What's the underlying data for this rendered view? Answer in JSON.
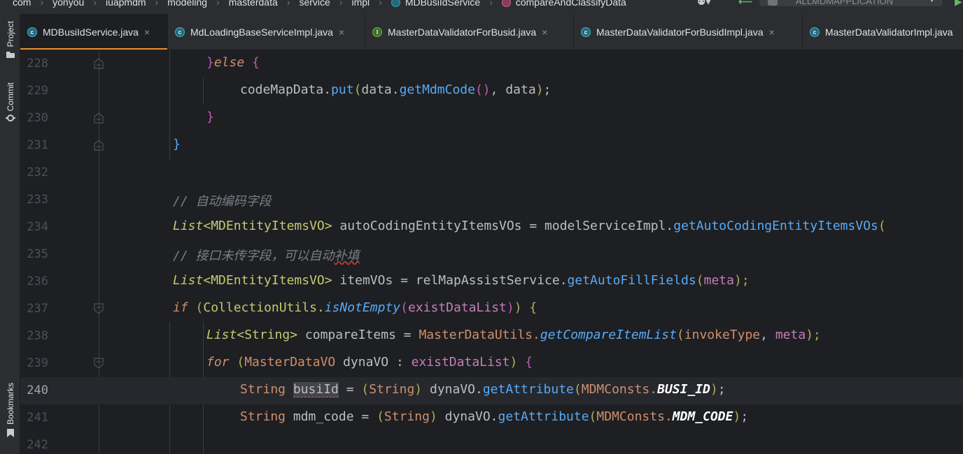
{
  "breadcrumb": {
    "items": [
      "com",
      "yonyou",
      "iuapmdm",
      "modeling",
      "masterdata",
      "service",
      "impl"
    ],
    "class_item": "MDBusiIdService",
    "method_item": "compareAndClassifyData",
    "run_config": "ALLMDMAPPLICATION"
  },
  "sidebar": {
    "project_label": "Project",
    "commit_label": "Commit",
    "bookmarks_label": "Bookmarks"
  },
  "tabs": [
    {
      "label": "MDBusiIdService.java",
      "icon": "class-icon",
      "active": true
    },
    {
      "label": "MdLoadingBaseServiceImpl.java",
      "icon": "class-icon",
      "active": false
    },
    {
      "label": "MasterDataValidatorForBusid.java",
      "icon": "interface-icon",
      "active": false
    },
    {
      "label": "MasterDataValidatorForBusidImpl.java",
      "icon": "class-icon",
      "active": false
    },
    {
      "label": "MasterDataValidatorImpl.java",
      "icon": "class-icon",
      "active": false
    }
  ],
  "tab_close_glyph": "×",
  "editor": {
    "line_numbers": [
      "228",
      "229",
      "230",
      "231",
      "232",
      "233",
      "234",
      "235",
      "236",
      "237",
      "238",
      "239",
      "240",
      "241",
      "242"
    ],
    "current_line": "240",
    "lines": {
      "l228": {
        "a": "}",
        "b": "else",
        "c": " {"
      },
      "l229": {
        "a": "codeMapData.",
        "b": "put",
        "c": "(",
        "d": "data.",
        "e": "getMdmCode",
        "f": "()",
        "g": ", data",
        "h": ")",
        "i": ";"
      },
      "l230": {
        "a": "}"
      },
      "l231": {
        "a": "}"
      },
      "l233": {
        "a": "// 自动编码字段"
      },
      "l234": {
        "a": "List",
        "b": "<MDEntityItemsVO>",
        "c": " autoCodingEntityItemsVOs = modelServiceImpl.",
        "d": "getAutoCodingEntityItemsVOs",
        "e": "("
      },
      "l235": {
        "a": "// 接口未传字段，可以自动",
        "b": "补填"
      },
      "l236": {
        "a": "List",
        "b": "<MDEntityItemsVO>",
        "c": " itemVOs = relMapAssistService.",
        "d": "getAutoFillFields",
        "e": "(",
        "f": "meta",
        "g": ");"
      },
      "l237": {
        "a": "if",
        "b": " (",
        "c": "CollectionUtils.",
        "d": "isNotEmpty",
        "e": "(",
        "f": "existDataList",
        "g": ")",
        "h": ")",
        "i": " {"
      },
      "l238": {
        "a": "List",
        "b": "<String>",
        "c": " compareItems = ",
        "d": "MasterDataUtils.",
        "e": "getCompareItemList",
        "f": "(",
        "g": "invokeType",
        "h": ", ",
        "i": "meta",
        "j": ");"
      },
      "l239": {
        "a": "for",
        "b": " (",
        "c": "MasterDataVO",
        "d": " dynaVO : ",
        "e": "existDataList",
        "f": ")",
        "g": " {"
      },
      "l240": {
        "a": "String",
        "b": " ",
        "c": "busiId",
        "d": " = ",
        "e": "(",
        "f": "String",
        "g": ")",
        "h": " dynaVO.",
        "i": "getAttribute",
        "j": "(",
        "k": "MDMConsts.",
        "l": "BUSI_ID",
        "m": ")",
        "n": ";"
      },
      "l241": {
        "a": "String",
        "b": " mdm_code = ",
        "c": "(",
        "d": "String",
        "e": ")",
        "f": " dynaVO.",
        "g": "getAttribute",
        "h": "(",
        "i": "MDMConsts.",
        "j": "MDM_CODE",
        "k": ")",
        "l": ";"
      }
    }
  },
  "colors": {
    "background": "#1e1f22",
    "panel": "#2b2d30",
    "active_tab_underline": "#e8902f",
    "keyword": "#cf8e6d",
    "method": "#57aaf7",
    "constant": "#c77dbb"
  }
}
